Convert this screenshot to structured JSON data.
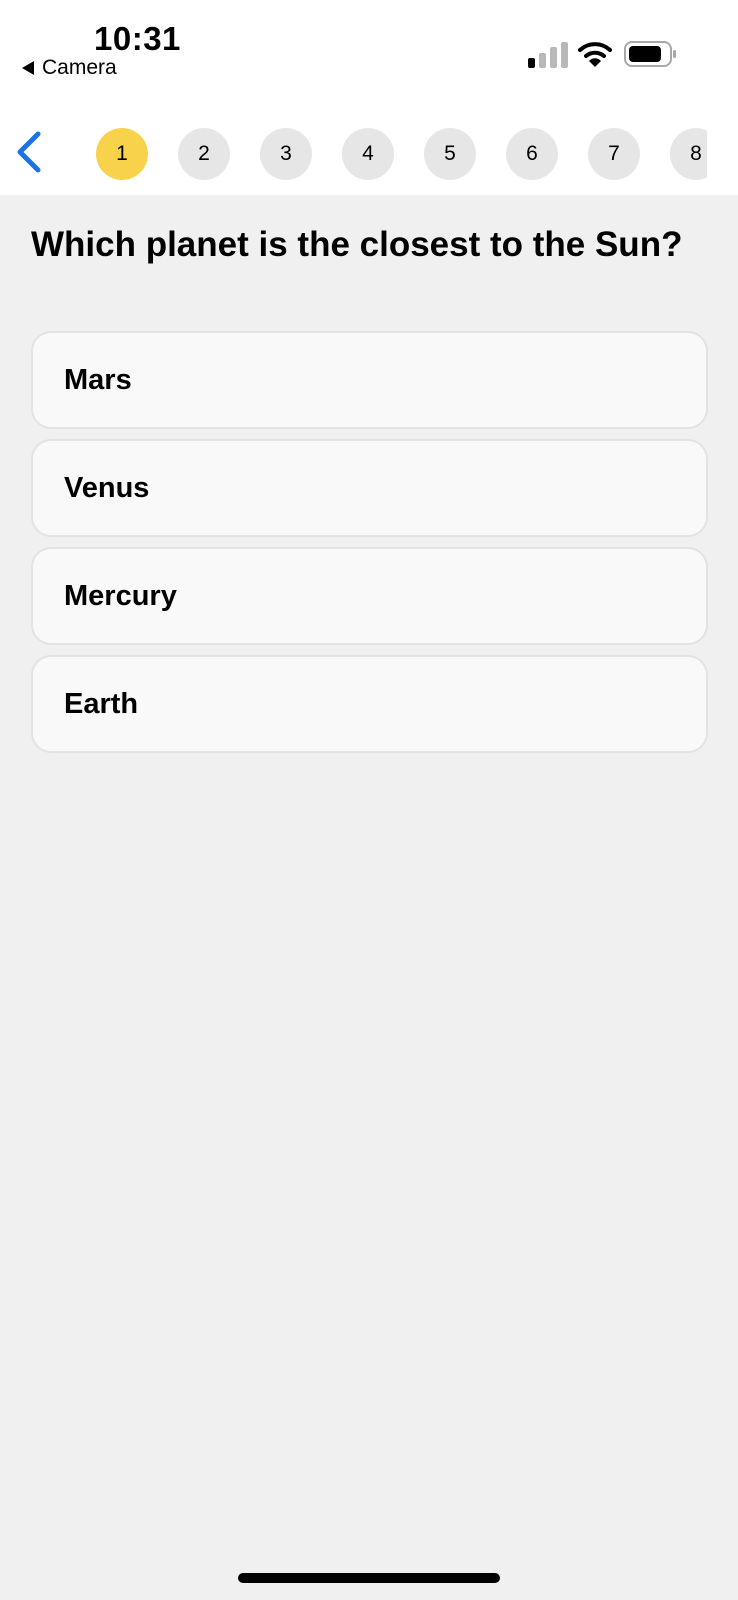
{
  "status_bar": {
    "time": "10:31",
    "back_app_label": "Camera",
    "icons": [
      "signal-icon",
      "wifi-icon",
      "battery-icon"
    ]
  },
  "nav": {
    "back_icon": "chevron-left-icon",
    "steps": [
      "1",
      "2",
      "3",
      "4",
      "5",
      "6",
      "7",
      "8"
    ],
    "active_step": "1"
  },
  "question": {
    "text": "Which planet is the closest to the Sun?"
  },
  "answers": [
    {
      "label": "Mars"
    },
    {
      "label": "Venus"
    },
    {
      "label": "Mercury"
    },
    {
      "label": "Earth"
    }
  ],
  "colors": {
    "accent_blue": "#1a73e8",
    "active_step": "#f8d24b",
    "inactive_step": "#e6e6e6",
    "background": "#f0f0f0"
  }
}
